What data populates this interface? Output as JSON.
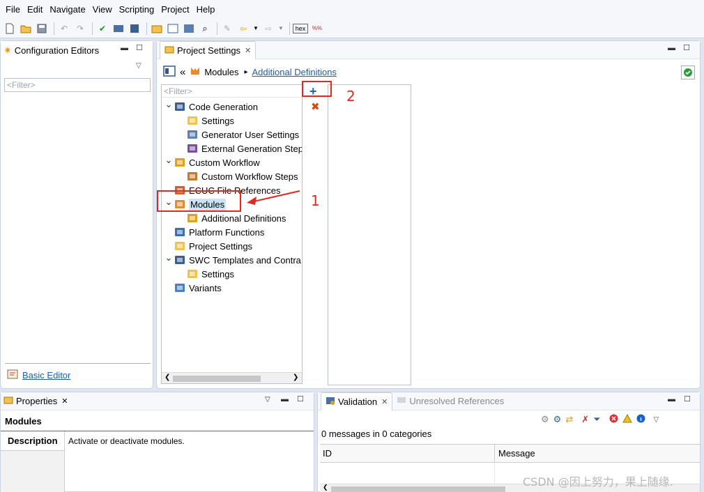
{
  "menu": [
    "File",
    "Edit",
    "Navigate",
    "View",
    "Scripting",
    "Project",
    "Help"
  ],
  "config_editors": {
    "title": "Configuration Editors",
    "filter_placeholder": "<Filter>",
    "basic_editor": "Basic Editor"
  },
  "project_settings": {
    "title": "Project Settings",
    "breadcrumb": {
      "back": "«",
      "modules": "Modules",
      "sep": "▸",
      "current": "Additional Definitions"
    },
    "filter_placeholder": "<Filter>",
    "tree": [
      {
        "label": "Code Generation",
        "level": 0,
        "expanded": true,
        "icon": "code-gen-icon"
      },
      {
        "label": "Settings",
        "level": 1,
        "icon": "settings-icon"
      },
      {
        "label": "Generator User Settings",
        "level": 1,
        "icon": "generator-icon"
      },
      {
        "label": "External Generation Step",
        "level": 1,
        "icon": "external-gen-icon"
      },
      {
        "label": "Custom Workflow",
        "level": 0,
        "expanded": true,
        "icon": "workflow-icon"
      },
      {
        "label": "Custom Workflow Steps",
        "level": 1,
        "icon": "workflow-steps-icon"
      },
      {
        "label": "ECUC File References",
        "level": 0,
        "icon": "ecuc-icon"
      },
      {
        "label": "Modules",
        "level": 0,
        "expanded": true,
        "selected": true,
        "icon": "modules-icon"
      },
      {
        "label": "Additional Definitions",
        "level": 1,
        "icon": "additional-def-icon"
      },
      {
        "label": "Platform Functions",
        "level": 0,
        "icon": "platform-icon"
      },
      {
        "label": "Project Settings",
        "level": 0,
        "icon": "project-settings-icon"
      },
      {
        "label": "SWC Templates and Contra",
        "level": 0,
        "expanded": true,
        "icon": "swc-icon"
      },
      {
        "label": "Settings",
        "level": 1,
        "icon": "settings-icon"
      },
      {
        "label": "Variants",
        "level": 0,
        "icon": "variants-icon"
      }
    ]
  },
  "annotations": {
    "one": "1",
    "two": "2"
  },
  "properties": {
    "title": "Properties",
    "section": "Modules",
    "desc_tab": "Description",
    "desc_text": "Activate or deactivate modules."
  },
  "validation": {
    "title": "Validation",
    "unresolved_tab": "Unresolved References",
    "summary": "0 messages in 0 categories",
    "col_id": "ID",
    "col_message": "Message"
  },
  "watermark": "CSDN @因上努力，果上随缘.",
  "colors": {
    "accent": "#1a5fb4",
    "annotation": "#e8261b",
    "selection": "#cce4f7",
    "add": "#1b62c6",
    "remove": "#d9480f"
  }
}
